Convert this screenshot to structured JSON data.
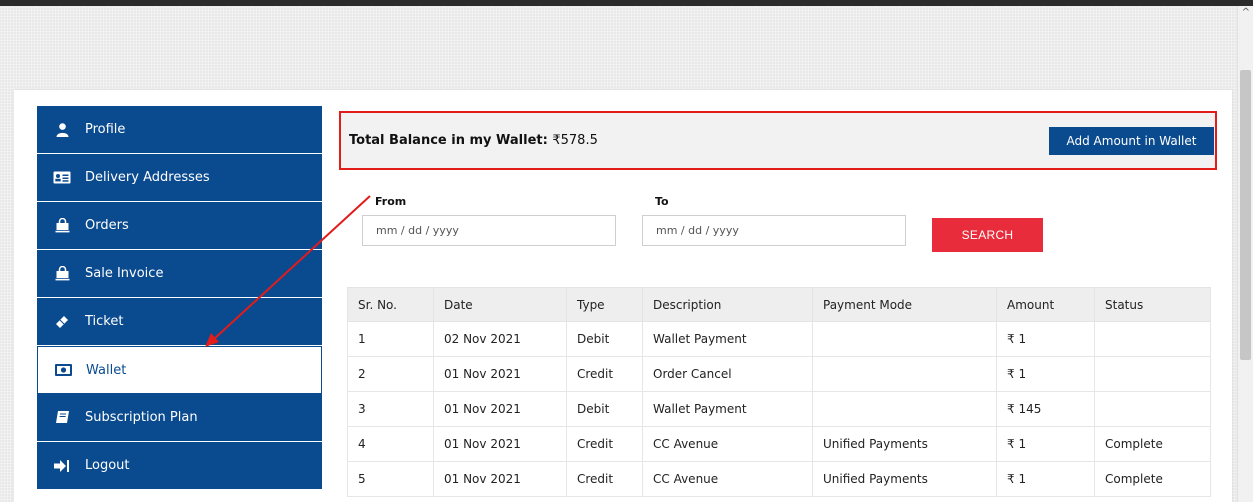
{
  "sidebar": {
    "items": [
      {
        "label": "Profile",
        "icon": "user-icon"
      },
      {
        "label": "Delivery Addresses",
        "icon": "address-card-icon"
      },
      {
        "label": "Orders",
        "icon": "shopping-bag-icon"
      },
      {
        "label": "Sale Invoice",
        "icon": "shopping-bag-icon"
      },
      {
        "label": "Ticket",
        "icon": "ticket-icon"
      },
      {
        "label": "Wallet",
        "icon": "money-bill-icon"
      },
      {
        "label": "Subscription Plan",
        "icon": "book-icon"
      },
      {
        "label": "Logout",
        "icon": "sign-out-icon"
      }
    ],
    "active": "Wallet"
  },
  "wallet": {
    "balance_label": "Total Balance in my Wallet:",
    "balance_value": "₹578.5",
    "add_button": "Add Amount in Wallet"
  },
  "filter": {
    "from_label": "From",
    "to_label": "To",
    "from_placeholder": "mm / dd / yyyy",
    "to_placeholder": "mm / dd / yyyy",
    "search_button": "SEARCH"
  },
  "table": {
    "headers": [
      "Sr. No.",
      "Date",
      "Type",
      "Description",
      "Payment Mode",
      "Amount",
      "Status"
    ],
    "rows": [
      [
        "1",
        "02 Nov 2021",
        "Debit",
        "Wallet Payment",
        "",
        "₹ 1",
        ""
      ],
      [
        "2",
        "01 Nov 2021",
        "Credit",
        "Order Cancel",
        "",
        "₹ 1",
        ""
      ],
      [
        "3",
        "01 Nov 2021",
        "Debit",
        "Wallet Payment",
        "",
        "₹ 145",
        ""
      ],
      [
        "4",
        "01 Nov 2021",
        "Credit",
        "CC Avenue",
        "Unified Payments",
        "₹ 1",
        "Complete"
      ],
      [
        "5",
        "01 Nov 2021",
        "Credit",
        "CC Avenue",
        "Unified Payments",
        "₹ 1",
        "Complete"
      ]
    ]
  },
  "colors": {
    "primary": "#0a4a8f",
    "accent_red": "#e82c3b",
    "highlight_border": "#e21b1b"
  }
}
